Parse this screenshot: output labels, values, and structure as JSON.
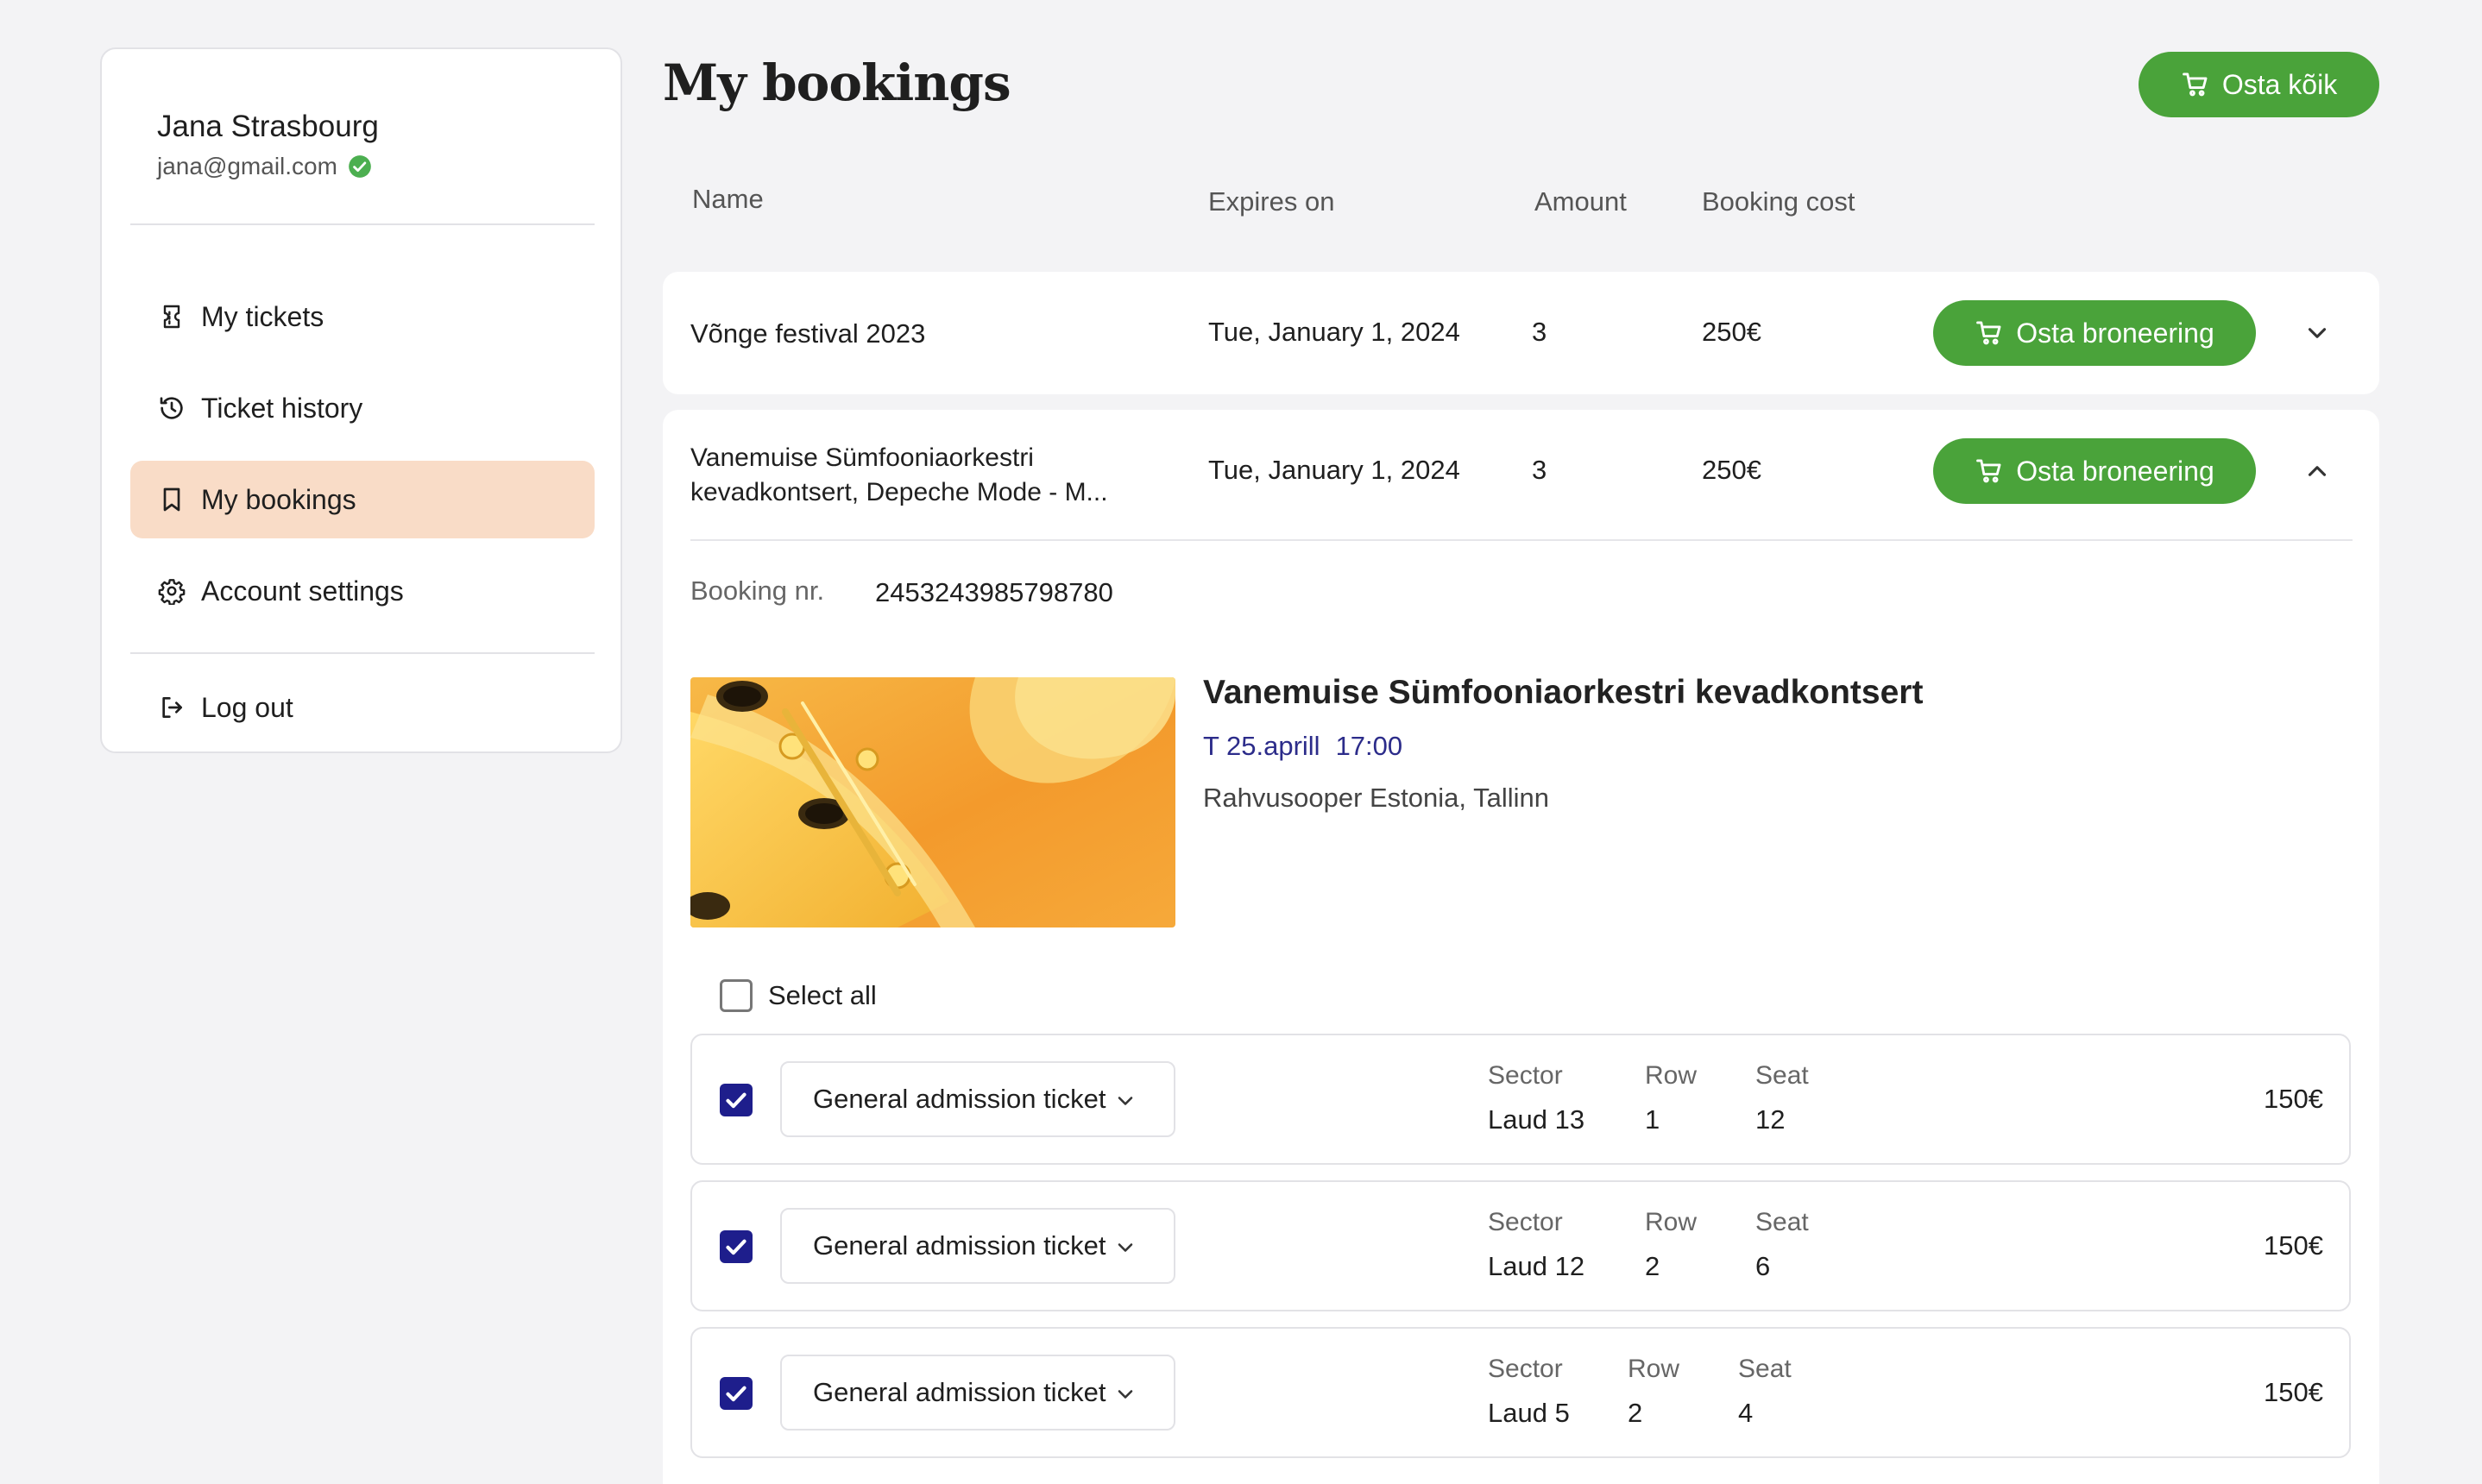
{
  "user": {
    "name": "Jana Strasbourg",
    "email": "jana@gmail.com"
  },
  "nav": [
    {
      "label": "My tickets",
      "icon": "ticket-icon"
    },
    {
      "label": "Ticket history",
      "icon": "history-icon"
    },
    {
      "label": "My bookings",
      "icon": "bookmark-icon",
      "active": true
    },
    {
      "label": "Account settings",
      "icon": "gear-icon"
    },
    {
      "label": "Log out",
      "icon": "logout-icon"
    }
  ],
  "page": {
    "title": "My bookings",
    "buy_all_label": "Osta kõik"
  },
  "columns": {
    "name": "Name",
    "expires": "Expires on",
    "amount": "Amount",
    "cost": "Booking cost"
  },
  "bookings": [
    {
      "name": "Võnge festival 2023",
      "expires": "Tue, January 1, 2024",
      "amount": "3",
      "cost": "250€",
      "buy_label": "Osta broneering",
      "expanded": false
    },
    {
      "name_line1": "Vanemuise Sümfooniaorkestri",
      "name_line2": "kevadkontsert, Depeche Mode - M...",
      "expires": "Tue, January 1, 2024",
      "amount": "3",
      "cost": "250€",
      "buy_label": "Osta broneering",
      "expanded": true,
      "booking_nr_label": "Booking nr.",
      "booking_nr": "2453243985798780",
      "event": {
        "title": "Vanemuise Sümfooniaorkestri kevadkontsert",
        "date": "T 25.aprill",
        "time": "17:00",
        "venue": "Rahvusooper Estonia, Tallinn"
      },
      "select_all_label": "Select all",
      "ticket_labels": {
        "sector": "Sector",
        "row": "Row",
        "seat": "Seat"
      },
      "tickets": [
        {
          "type": "General admission ticket",
          "sector": "Laud 13",
          "row": "1",
          "seat": "12",
          "price": "150€",
          "checked": true
        },
        {
          "type": "General admission ticket",
          "sector": "Laud 12",
          "row": "2",
          "seat": "6",
          "price": "150€",
          "checked": true
        },
        {
          "type": "General admission ticket",
          "sector": "Laud 5",
          "row": "2",
          "seat": "4",
          "price": "150€",
          "checked": true
        }
      ]
    }
  ],
  "colors": {
    "accent_green": "#4aa33a",
    "active_nav": "#f9dcc7",
    "checkbox_blue": "#1e1e8c",
    "event_date": "#2c2c8a",
    "verified": "#4caf50"
  }
}
